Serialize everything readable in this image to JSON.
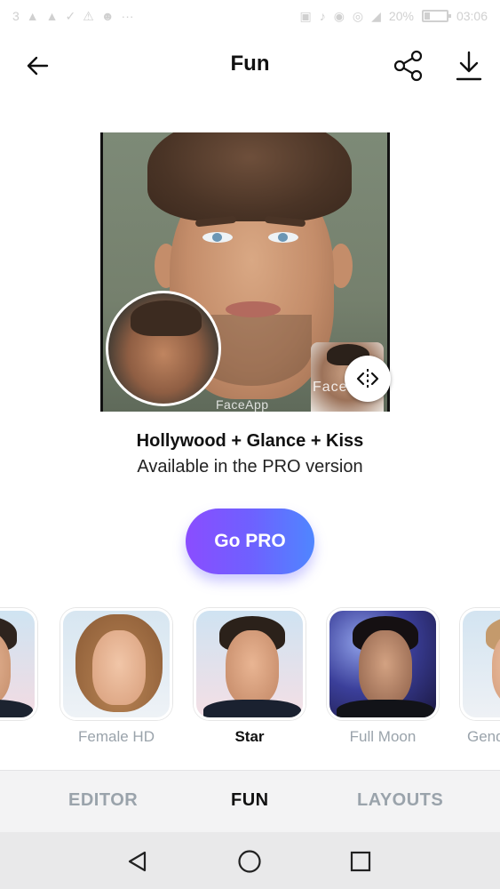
{
  "status_bar": {
    "left_text": "3",
    "left_icons": [
      "notification-icon",
      "notification-icon",
      "check-icon",
      "warning-icon",
      "person-icon",
      "more-dots-icon"
    ],
    "battery": "20%",
    "time": "03:06"
  },
  "header": {
    "title": "Fun",
    "back_icon": "arrow-left-icon",
    "share_icon": "share-icon",
    "download_icon": "download-icon"
  },
  "preview": {
    "face_label": "Face",
    "watermark": "FaceApp"
  },
  "filter_info": {
    "title": "Hollywood + Glance + Kiss",
    "subtitle": "Available in the PRO version"
  },
  "go_pro": {
    "label": "Go PRO"
  },
  "filters": [
    {
      "label": "e",
      "selected": false
    },
    {
      "label": "Female HD",
      "selected": false
    },
    {
      "label": "Star",
      "selected": true
    },
    {
      "label": "Full Moon",
      "selected": false
    },
    {
      "label": "Gend",
      "selected": false
    }
  ],
  "tabs": [
    {
      "label": "EDITOR",
      "active": false
    },
    {
      "label": "FUN",
      "active": true
    },
    {
      "label": "LAYOUTS",
      "active": false
    }
  ],
  "navbar": {
    "back_icon": "triangle-back-icon",
    "home_icon": "circle-home-icon",
    "recent_icon": "square-recent-icon"
  },
  "colors": {
    "accent_gradient_start": "#8a4dff",
    "accent_gradient_end": "#4f86ff",
    "inactive_text": "#9aa3ab",
    "active_text": "#111111"
  }
}
